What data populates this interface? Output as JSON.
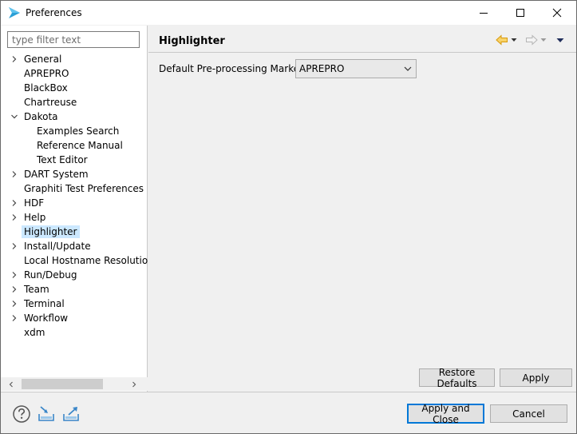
{
  "window": {
    "title": "Preferences",
    "controls": [
      "minimize",
      "maximize",
      "close"
    ]
  },
  "sidebar": {
    "filter_placeholder": "type filter text",
    "items": [
      {
        "label": "General",
        "expander": "collapsed",
        "indent": 0
      },
      {
        "label": "APREPRO",
        "expander": "none",
        "indent": 0
      },
      {
        "label": "BlackBox",
        "expander": "none",
        "indent": 0
      },
      {
        "label": "Chartreuse",
        "expander": "none",
        "indent": 0
      },
      {
        "label": "Dakota",
        "expander": "expanded",
        "indent": 0
      },
      {
        "label": "Examples Search",
        "expander": "none",
        "indent": 1
      },
      {
        "label": "Reference Manual",
        "expander": "none",
        "indent": 1
      },
      {
        "label": "Text Editor",
        "expander": "none",
        "indent": 1
      },
      {
        "label": "DART System",
        "expander": "collapsed",
        "indent": 0
      },
      {
        "label": "Graphiti Test Preferences",
        "expander": "none",
        "indent": 0
      },
      {
        "label": "HDF",
        "expander": "collapsed",
        "indent": 0
      },
      {
        "label": "Help",
        "expander": "collapsed",
        "indent": 0
      },
      {
        "label": "Highlighter",
        "expander": "none",
        "indent": 0,
        "selected": true
      },
      {
        "label": "Install/Update",
        "expander": "collapsed",
        "indent": 0
      },
      {
        "label": "Local Hostname Resolution",
        "expander": "none",
        "indent": 0
      },
      {
        "label": "Run/Debug",
        "expander": "collapsed",
        "indent": 0
      },
      {
        "label": "Team",
        "expander": "collapsed",
        "indent": 0
      },
      {
        "label": "Terminal",
        "expander": "collapsed",
        "indent": 0
      },
      {
        "label": "Workflow",
        "expander": "collapsed",
        "indent": 0
      },
      {
        "label": "xdm",
        "expander": "none",
        "indent": 0
      }
    ]
  },
  "main": {
    "title": "Highlighter",
    "field_label": "Default Pre-processing Marker:",
    "marker_value": "APREPRO",
    "restore_defaults_label": "Restore Defaults",
    "apply_label": "Apply"
  },
  "footer": {
    "apply_close_label": "Apply and Close",
    "cancel_label": "Cancel"
  },
  "colors": {
    "accent": "#0078d7",
    "selection": "#cce8ff",
    "back_arrow": "#e6a817",
    "app_icon": "#2a9fd6"
  }
}
